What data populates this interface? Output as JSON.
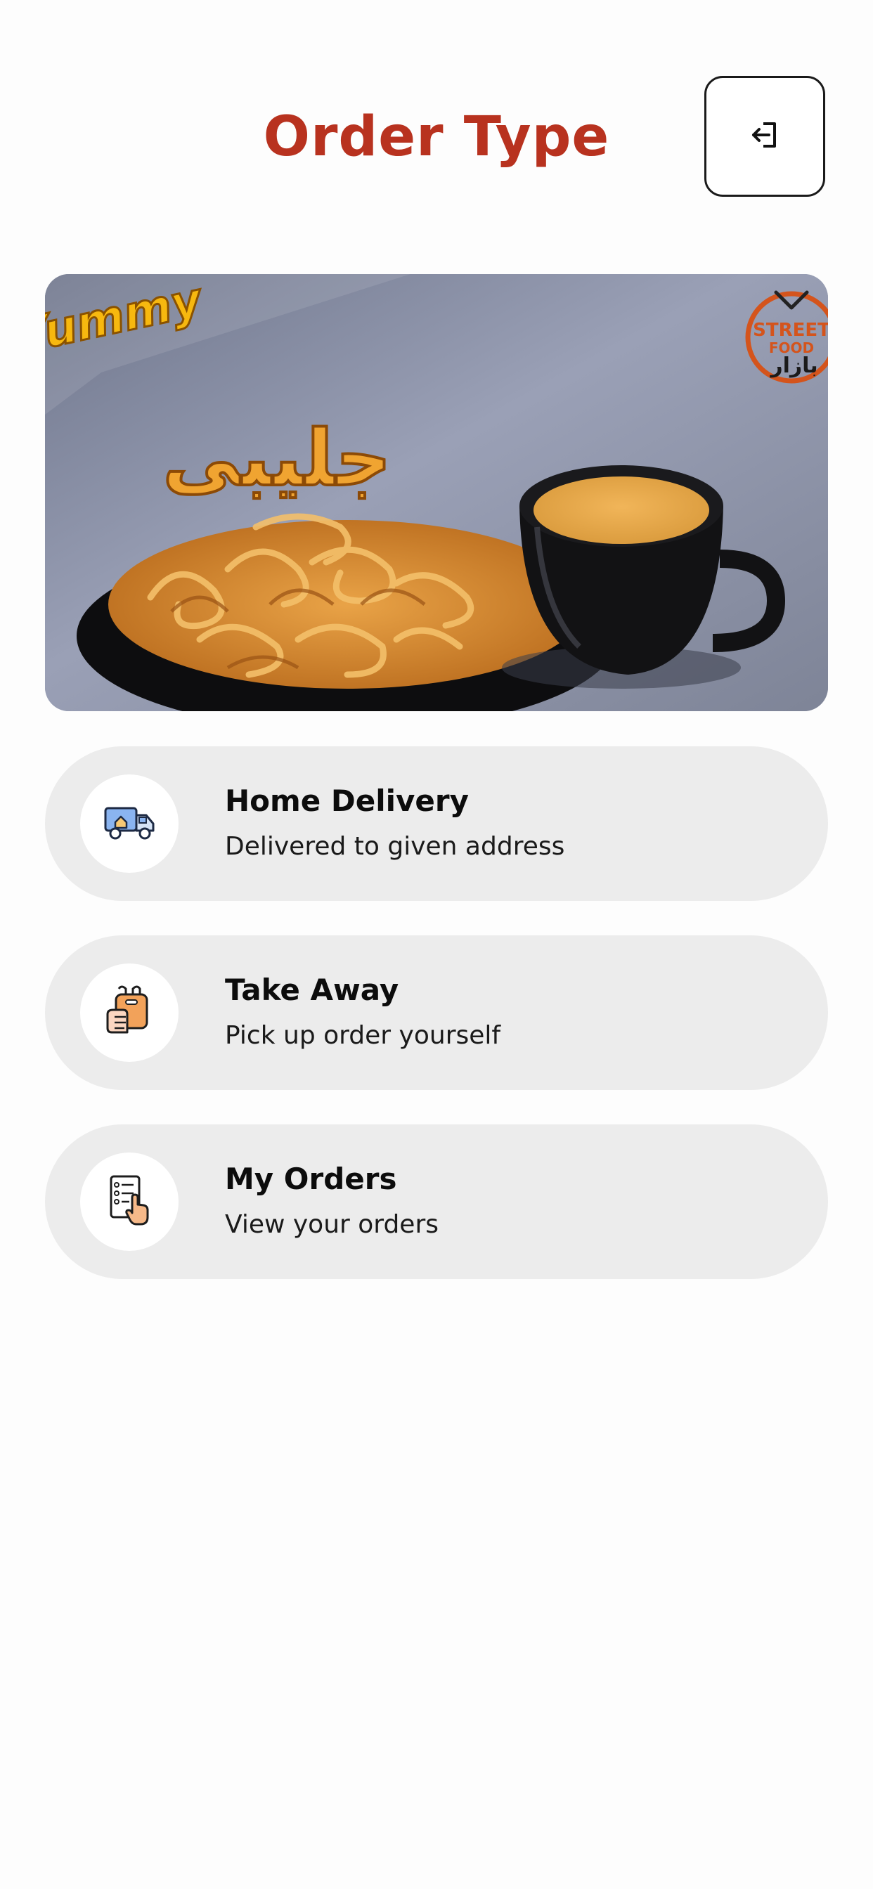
{
  "header": {
    "title": "Order Type",
    "logout_icon": "logout-icon"
  },
  "banner": {
    "logo_left": "Yummy",
    "dish_name": "جلیبی",
    "logo_right_line1": "STREET",
    "logo_right_line2": "FOOD",
    "logo_right_line3": "بازار"
  },
  "options": [
    {
      "title": "Home Delivery",
      "subtitle": "Delivered to given address",
      "icon": "delivery-truck-icon"
    },
    {
      "title": "Take Away",
      "subtitle": "Pick up order yourself",
      "icon": "takeaway-bag-icon"
    },
    {
      "title": "My Orders",
      "subtitle": "View your orders",
      "icon": "order-list-icon"
    }
  ],
  "colors": {
    "accent": "#b8321f",
    "option_bg": "#ececec",
    "icon_bg": "#ffffff"
  }
}
